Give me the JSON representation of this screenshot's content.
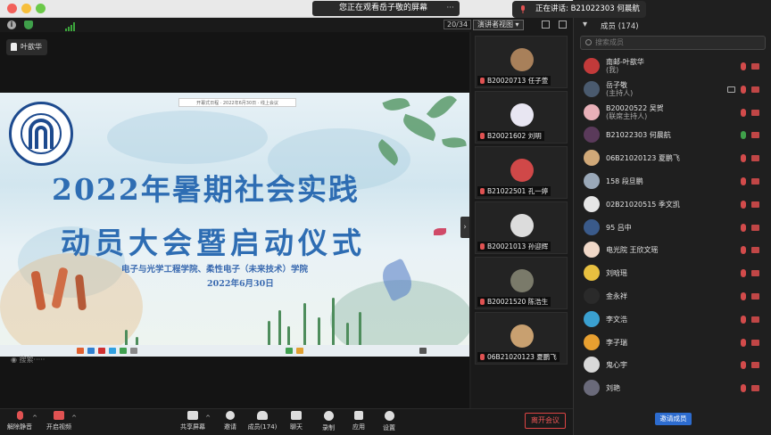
{
  "topbar": {
    "viewing_text": "您正在观看岳子敬的屏幕",
    "options_glyph": "···",
    "speaking_text": "正在讲话: B21022303 何晨航"
  },
  "subbar": {
    "zoom": "20/34",
    "view_option": "演讲者视图"
  },
  "stage": {
    "pinned_label": "叶歆华",
    "slide": {
      "top_note": "开幕式日程 · 2022年6月30日 · 线上会议",
      "title_line1": "2022年暑期社会实践",
      "title_line2": "动员大会暨启动仪式",
      "subtitle": "电子与光学工程学院、柔性电子（未来技术）学院",
      "date": "2022年6月30日"
    },
    "search_hint": "搜索·····",
    "expand_glyph": "›"
  },
  "thumbnails": [
    {
      "label": "B20020713 任子萱",
      "avatar_bg": "#a8805a"
    },
    {
      "label": "B20021602 刘明",
      "avatar_bg": "#e8e6f2"
    },
    {
      "label": "B21022501 孔一婷",
      "avatar_bg": "#d04848"
    },
    {
      "label": "B20021013 孙迎辉",
      "avatar_bg": "#dcdcdc"
    },
    {
      "label": "B20021520 陈浩生",
      "avatar_bg": "#7a7a6a"
    },
    {
      "label": "06B21020123 夏鹏飞",
      "avatar_bg": "#c8a070"
    }
  ],
  "panel": {
    "title": "成员 (174)",
    "search_placeholder": "搜索成员",
    "invite_label": "邀请成员",
    "participants": [
      {
        "name": "南邮-叶歆华",
        "sub": "(我)",
        "avatar_bg": "#c23a3a",
        "mic": "muted",
        "share": false
      },
      {
        "name": "岳子敬",
        "sub": "(主持人)",
        "avatar_bg": "#4a5a6e",
        "mic": "muted",
        "share": true
      },
      {
        "name": "B20020522 吴贺",
        "sub": "(联席主持人)",
        "avatar_bg": "#e8b0b8",
        "mic": "muted",
        "share": false
      },
      {
        "name": "B21022303 何晨航",
        "sub": "",
        "avatar_bg": "#5a3a5a",
        "mic": "live",
        "share": false
      },
      {
        "name": "06B21020123 夏鹏飞",
        "sub": "",
        "avatar_bg": "#d0a878",
        "mic": "muted",
        "share": false
      },
      {
        "name": "158 段旦鹏",
        "sub": "",
        "avatar_bg": "#9aa8b8",
        "mic": "muted",
        "share": false
      },
      {
        "name": "02B21020515 季文凯",
        "sub": "",
        "avatar_bg": "#e6e6e6",
        "mic": "muted",
        "share": false
      },
      {
        "name": "95 吕中",
        "sub": "",
        "avatar_bg": "#3a5a8a",
        "mic": "muted",
        "share": false
      },
      {
        "name": "电光院  王欣文瑶",
        "sub": "",
        "avatar_bg": "#f0d8c8",
        "mic": "muted",
        "share": false
      },
      {
        "name": "刘晗瑶",
        "sub": "",
        "avatar_bg": "#e8c040",
        "mic": "muted",
        "share": false
      },
      {
        "name": "金永祥",
        "sub": "",
        "avatar_bg": "#2a2a2a",
        "mic": "muted",
        "share": false
      },
      {
        "name": "李文浩",
        "sub": "",
        "avatar_bg": "#3aa0d0",
        "mic": "muted",
        "share": false
      },
      {
        "name": "李子瑞",
        "sub": "",
        "avatar_bg": "#e8a030",
        "mic": "muted",
        "share": false
      },
      {
        "name": "鬼心宇",
        "sub": "",
        "avatar_bg": "#d8d8d8",
        "mic": "muted",
        "share": false
      },
      {
        "name": "刘艳",
        "sub": "",
        "avatar_bg": "#6a6a7a",
        "mic": "muted",
        "share": false
      }
    ]
  },
  "toolbar": {
    "tools": [
      {
        "label": "解除静音",
        "icon": "mic-muted-icon"
      },
      {
        "label": "开启视频",
        "icon": "video-off-icon"
      },
      {
        "label": "共享屏幕",
        "icon": "share-screen-icon"
      },
      {
        "label": "邀请",
        "icon": "invite-icon"
      },
      {
        "label": "成员(174)",
        "icon": "members-icon"
      },
      {
        "label": "聊天",
        "icon": "chat-icon"
      },
      {
        "label": "录制",
        "icon": "record-icon"
      },
      {
        "label": "应用",
        "icon": "apps-icon"
      },
      {
        "label": "设置",
        "icon": "settings-icon"
      }
    ],
    "leave_label": "离开会议"
  },
  "colors": {
    "accent": "#2d6ccf",
    "muted_red": "#d24b4b",
    "live_green": "#3fa04a",
    "slide_title": "#2e6db3"
  }
}
